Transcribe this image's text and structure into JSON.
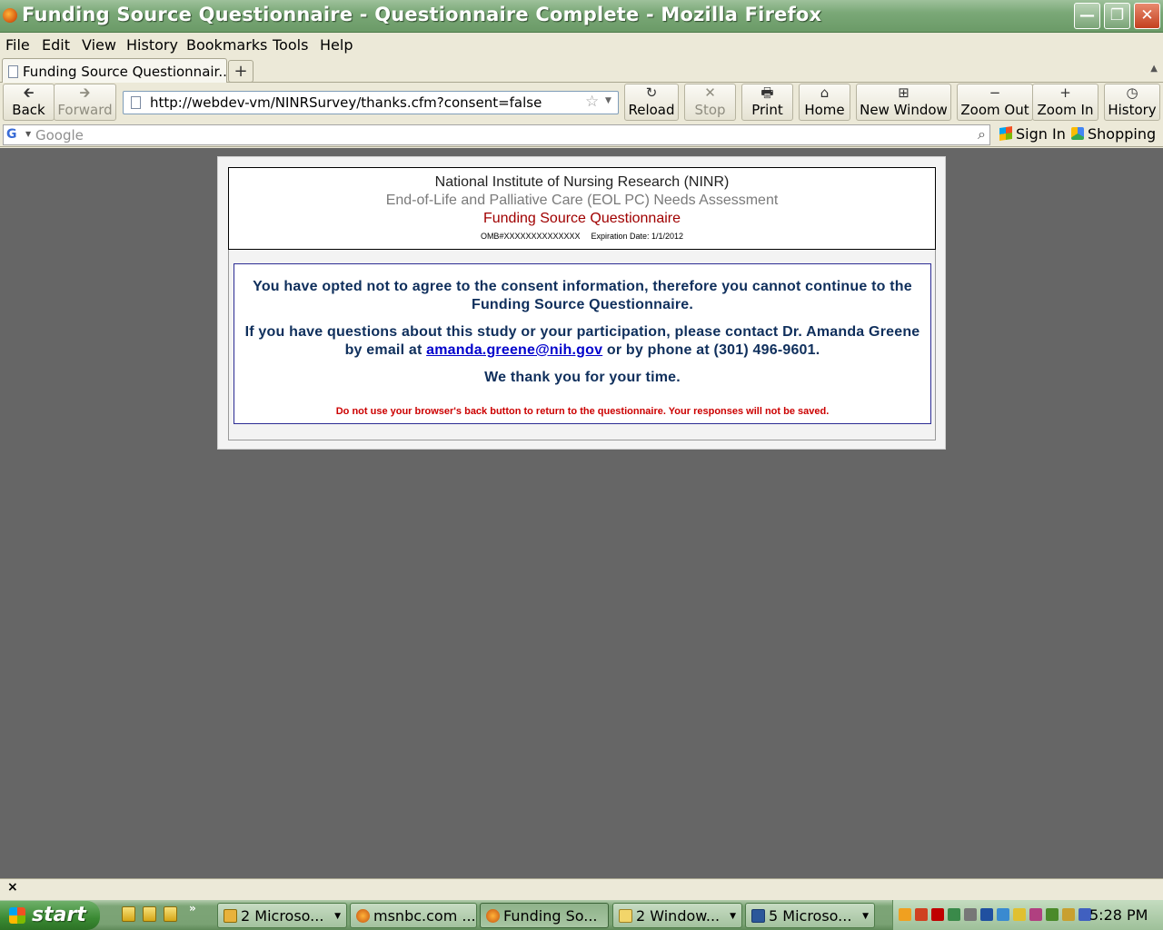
{
  "window": {
    "title": "Funding Source Questionnaire - Questionnaire Complete - Mozilla Firefox",
    "minimize_glyph": "—",
    "maximize_glyph": "❐",
    "close_glyph": "✕"
  },
  "menu": {
    "items": [
      "File",
      "Edit",
      "View",
      "History",
      "Bookmarks",
      "Tools",
      "Help"
    ]
  },
  "tabs": {
    "active_label": "Funding Source Questionnair...",
    "new_tab_glyph": "+"
  },
  "toolbar": {
    "back": "Back",
    "forward": "Forward",
    "reload": "Reload",
    "stop": "Stop",
    "print": "Print",
    "home": "Home",
    "new_window": "New Window",
    "zoom_out": "Zoom Out",
    "zoom_in": "Zoom In",
    "history": "History",
    "url": "http://webdev-vm/NINRSurvey/thanks.cfm?consent=false"
  },
  "google_bar": {
    "placeholder": "Google",
    "sign_in": "Sign In",
    "shopping": "Shopping"
  },
  "page": {
    "org": "National Institute of Nursing Research (NINR)",
    "assessment": "End-of-Life and Palliative Care (EOL PC) Needs Assessment",
    "questionnaire": "Funding Source Questionnaire",
    "omb": "OMB#XXXXXXXXXXXXXX",
    "expiration": "Expiration Date: 1/1/2012",
    "msg_consent": "You have opted not to agree to the consent information, therefore you cannot continue to the Funding Source Questionnaire.",
    "msg_questions_pre": "If you have questions about this study or your participation, please contact Dr. Amanda Greene by email at ",
    "email": "amanda.greene@nih.gov",
    "msg_questions_post": " or by phone at (301) 496-9601.",
    "thanks": "We thank you for your time.",
    "warning": "Do not use your browser's back button to return to the questionnaire. Your responses will not be saved."
  },
  "statusbar": {
    "close_glyph": "×"
  },
  "taskbar": {
    "start": "start",
    "more": "»",
    "tasks": [
      "2 Microso...",
      "msnbc.com ...",
      "Funding So...",
      "2 Window...",
      "5 Microso..."
    ],
    "clock": "5:28 PM"
  }
}
